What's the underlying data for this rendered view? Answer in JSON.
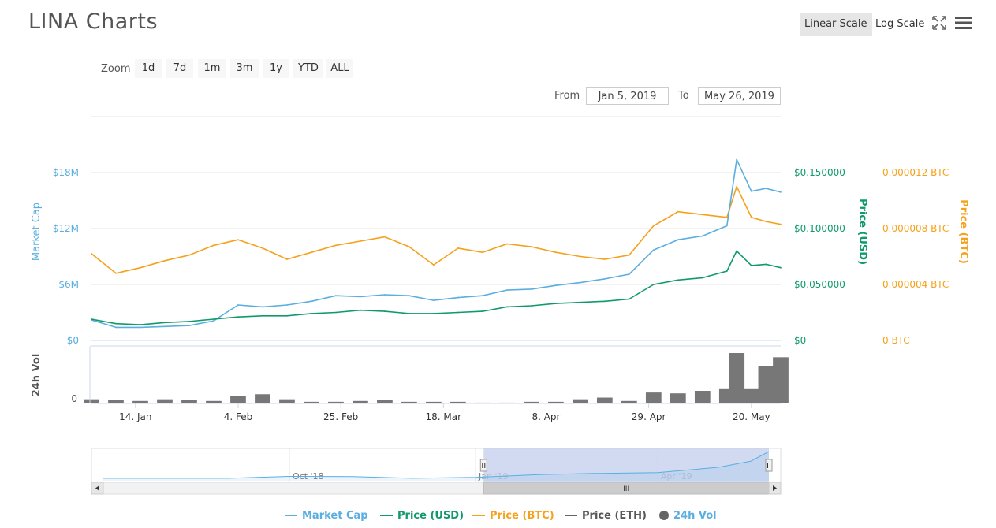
{
  "title": "LINA Charts",
  "scale": {
    "linear": "Linear Scale",
    "log": "Log Scale",
    "active": "linear"
  },
  "icons": {
    "fullscreen": "fullscreen-icon",
    "menu": "hamburger-menu-icon"
  },
  "zoom": {
    "label": "Zoom",
    "buttons": [
      "1d",
      "7d",
      "1m",
      "3m",
      "1y",
      "YTD",
      "ALL"
    ]
  },
  "range": {
    "from_label": "From",
    "from_value": "Jan 5, 2019",
    "to_label": "To",
    "to_value": "May 26, 2019"
  },
  "colors": {
    "market_cap": "#5aaee0",
    "price_usd": "#109a6a",
    "price_btc": "#f5a11b",
    "price_eth": "#666666",
    "volume": "#777777",
    "navigator_mask": "#c5d1ee"
  },
  "chart_data": {
    "type": "line",
    "x_range": [
      "2019-01-05",
      "2019-05-26"
    ],
    "x_ticks": [
      "14. Jan",
      "4. Feb",
      "25. Feb",
      "18. Mar",
      "8. Apr",
      "29. Apr",
      "20. May"
    ],
    "x_tick_dates": [
      "2019-01-14",
      "2019-02-04",
      "2019-02-25",
      "2019-03-18",
      "2019-04-08",
      "2019-04-29",
      "2019-05-20"
    ],
    "axes": {
      "market_cap": {
        "label": "Market Cap",
        "ticks": [
          "$0",
          "$6M",
          "$12M",
          "$18M"
        ],
        "tick_values": [
          0,
          6000000,
          12000000,
          18000000
        ],
        "range": [
          0,
          24000000
        ]
      },
      "price_usd": {
        "label": "Price (USD)",
        "ticks": [
          "$0",
          "$0.050000",
          "$0.100000",
          "$0.150000"
        ],
        "tick_values": [
          0,
          0.05,
          0.1,
          0.15
        ],
        "range": [
          0,
          0.2
        ]
      },
      "price_btc": {
        "label": "Price (BTC)",
        "ticks": [
          "0 BTC",
          "0.000004 BTC",
          "0.000008 BTC",
          "0.000012 BTC"
        ],
        "tick_values": [
          0,
          4e-06,
          8e-06,
          1.2e-05
        ],
        "range": [
          0,
          1.6e-05
        ]
      },
      "volume": {
        "label": "24h Vol",
        "ticks": [
          "0"
        ]
      }
    },
    "series": [
      {
        "name": "Market Cap",
        "axis": "market_cap",
        "x": [
          "2019-01-05",
          "2019-01-10",
          "2019-01-15",
          "2019-01-20",
          "2019-01-25",
          "2019-01-30",
          "2019-02-04",
          "2019-02-09",
          "2019-02-14",
          "2019-02-19",
          "2019-02-24",
          "2019-03-01",
          "2019-03-06",
          "2019-03-11",
          "2019-03-16",
          "2019-03-21",
          "2019-03-26",
          "2019-03-31",
          "2019-04-05",
          "2019-04-10",
          "2019-04-15",
          "2019-04-20",
          "2019-04-25",
          "2019-04-30",
          "2019-05-05",
          "2019-05-10",
          "2019-05-15",
          "2019-05-17",
          "2019-05-20",
          "2019-05-23",
          "2019-05-26"
        ],
        "y": [
          2200000,
          1400000,
          1400000,
          1500000,
          1600000,
          2100000,
          3800000,
          3600000,
          3800000,
          4200000,
          4800000,
          4700000,
          4900000,
          4800000,
          4300000,
          4600000,
          4800000,
          5400000,
          5500000,
          5900000,
          6200000,
          6600000,
          7100000,
          9700000,
          10800000,
          11200000,
          12300000,
          19400000,
          16000000,
          16300000,
          15900000
        ]
      },
      {
        "name": "Price (USD)",
        "axis": "price_usd",
        "x": [
          "2019-01-05",
          "2019-01-10",
          "2019-01-15",
          "2019-01-20",
          "2019-01-25",
          "2019-01-30",
          "2019-02-04",
          "2019-02-09",
          "2019-02-14",
          "2019-02-19",
          "2019-02-24",
          "2019-03-01",
          "2019-03-06",
          "2019-03-11",
          "2019-03-16",
          "2019-03-21",
          "2019-03-26",
          "2019-03-31",
          "2019-04-05",
          "2019-04-10",
          "2019-04-15",
          "2019-04-20",
          "2019-04-25",
          "2019-04-30",
          "2019-05-05",
          "2019-05-10",
          "2019-05-15",
          "2019-05-17",
          "2019-05-20",
          "2019-05-23",
          "2019-05-26"
        ],
        "y": [
          0.019,
          0.015,
          0.014,
          0.016,
          0.017,
          0.019,
          0.021,
          0.022,
          0.022,
          0.024,
          0.025,
          0.027,
          0.026,
          0.024,
          0.024,
          0.025,
          0.026,
          0.03,
          0.031,
          0.033,
          0.034,
          0.035,
          0.037,
          0.05,
          0.054,
          0.056,
          0.062,
          0.08,
          0.067,
          0.068,
          0.065
        ]
      },
      {
        "name": "Price (BTC)",
        "axis": "price_btc",
        "x": [
          "2019-01-05",
          "2019-01-10",
          "2019-01-15",
          "2019-01-20",
          "2019-01-25",
          "2019-01-30",
          "2019-02-04",
          "2019-02-09",
          "2019-02-14",
          "2019-02-19",
          "2019-02-24",
          "2019-03-01",
          "2019-03-06",
          "2019-03-11",
          "2019-03-16",
          "2019-03-21",
          "2019-03-26",
          "2019-03-31",
          "2019-04-05",
          "2019-04-10",
          "2019-04-15",
          "2019-04-20",
          "2019-04-25",
          "2019-04-30",
          "2019-05-05",
          "2019-05-10",
          "2019-05-15",
          "2019-05-17",
          "2019-05-20",
          "2019-05-23",
          "2019-05-26"
        ],
        "y": [
          6.2e-06,
          4.8e-06,
          5.2e-06,
          5.7e-06,
          6.1e-06,
          6.8e-06,
          7.2e-06,
          6.6e-06,
          5.8e-06,
          6.3e-06,
          6.8e-06,
          7.1e-06,
          7.4e-06,
          6.7e-06,
          5.4e-06,
          6.6e-06,
          6.3e-06,
          6.9e-06,
          6.7e-06,
          6.3e-06,
          6e-06,
          5.8e-06,
          6.1e-06,
          8.2e-06,
          9.2e-06,
          9e-06,
          8.8e-06,
          1.1e-05,
          8.8e-06,
          8.5e-06,
          8.3e-06
        ]
      },
      {
        "name": "Price (ETH)",
        "axis": "price_btc",
        "x": [],
        "y": []
      },
      {
        "name": "24h Vol",
        "axis": "volume",
        "x": [
          "2019-01-05",
          "2019-01-10",
          "2019-01-15",
          "2019-01-20",
          "2019-01-25",
          "2019-01-30",
          "2019-02-04",
          "2019-02-09",
          "2019-02-14",
          "2019-02-19",
          "2019-02-24",
          "2019-03-01",
          "2019-03-06",
          "2019-03-11",
          "2019-03-16",
          "2019-03-21",
          "2019-03-26",
          "2019-03-31",
          "2019-04-05",
          "2019-04-10",
          "2019-04-15",
          "2019-04-20",
          "2019-04-25",
          "2019-04-30",
          "2019-05-05",
          "2019-05-10",
          "2019-05-15",
          "2019-05-17",
          "2019-05-20",
          "2019-05-23",
          "2019-05-26"
        ],
        "y": [
          5,
          4,
          3,
          5,
          4,
          3,
          9,
          11,
          5,
          2,
          2,
          3,
          4,
          2,
          2,
          2,
          1,
          1,
          2,
          2,
          5,
          7,
          3,
          13,
          12,
          15,
          18,
          60,
          18,
          45,
          55
        ]
      }
    ],
    "legend": [
      "Market Cap",
      "Price (USD)",
      "Price (BTC)",
      "Price (ETH)",
      "24h Vol"
    ],
    "legend_placement": "bottom-center",
    "grid": true
  },
  "navigator": {
    "labels": [
      "Oct '18",
      "Jan '19",
      "Apr '19"
    ],
    "label_dates": [
      "2018-10-01",
      "2019-01-01",
      "2019-04-01"
    ],
    "range": [
      "2018-07-01",
      "2019-05-26"
    ],
    "selected": [
      "2019-01-05",
      "2019-05-26"
    ],
    "series_name": "Market Cap",
    "x": [
      "2018-07-01",
      "2018-08-01",
      "2018-08-15",
      "2018-09-01",
      "2018-10-01",
      "2018-11-01",
      "2018-12-01",
      "2019-01-01",
      "2019-02-01",
      "2019-03-01",
      "2019-04-01",
      "2019-05-01",
      "2019-05-17",
      "2019-05-26"
    ],
    "y": [
      1,
      1,
      1,
      1,
      1.8,
      1.7,
      1.0,
      1.4,
      2.5,
      3.0,
      3.3,
      5.5,
      8.0,
      12.0
    ],
    "thumb_label": "III"
  }
}
